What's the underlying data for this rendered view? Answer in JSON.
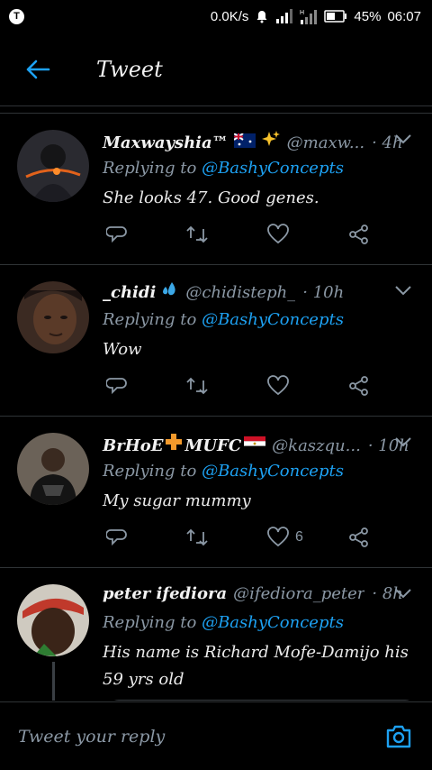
{
  "status_bar": {
    "network_speed": "0.0K/s",
    "battery": "45%",
    "time": "06:07"
  },
  "app_bar": {
    "title": "Tweet"
  },
  "tweets": [
    {
      "name": "Maxwayshia™",
      "handle": "@maxw...",
      "time": "· 4h",
      "replying_label": "Replying to",
      "mention": "@BashyConcepts",
      "text": "She looks 47. Good genes.",
      "likes": ""
    },
    {
      "name": "_chidi",
      "handle": "@chidisteph_",
      "time": "· 10h",
      "replying_label": "Replying to",
      "mention": "@BashyConcepts",
      "text": "Wow",
      "likes": ""
    },
    {
      "name": "BrHoE",
      "name_suffix": "MUFC",
      "handle": "@kaszqu...",
      "time": "· 10h",
      "replying_label": "Replying to",
      "mention": "@BashyConcepts",
      "text": "My sugar mummy",
      "likes": "6"
    },
    {
      "name": "peter ifediora",
      "handle": "@ifediora_peter",
      "time": "· 8h",
      "replying_label": "Replying to",
      "mention": "@BashyConcepts",
      "text": "His name is Richard Mofe-Damijo his 59 yrs old",
      "likes": ""
    }
  ],
  "composer": {
    "placeholder": "Tweet your reply"
  },
  "colors": {
    "accent": "#1da1f2",
    "muted": "#8b98a5",
    "background": "#000000"
  }
}
